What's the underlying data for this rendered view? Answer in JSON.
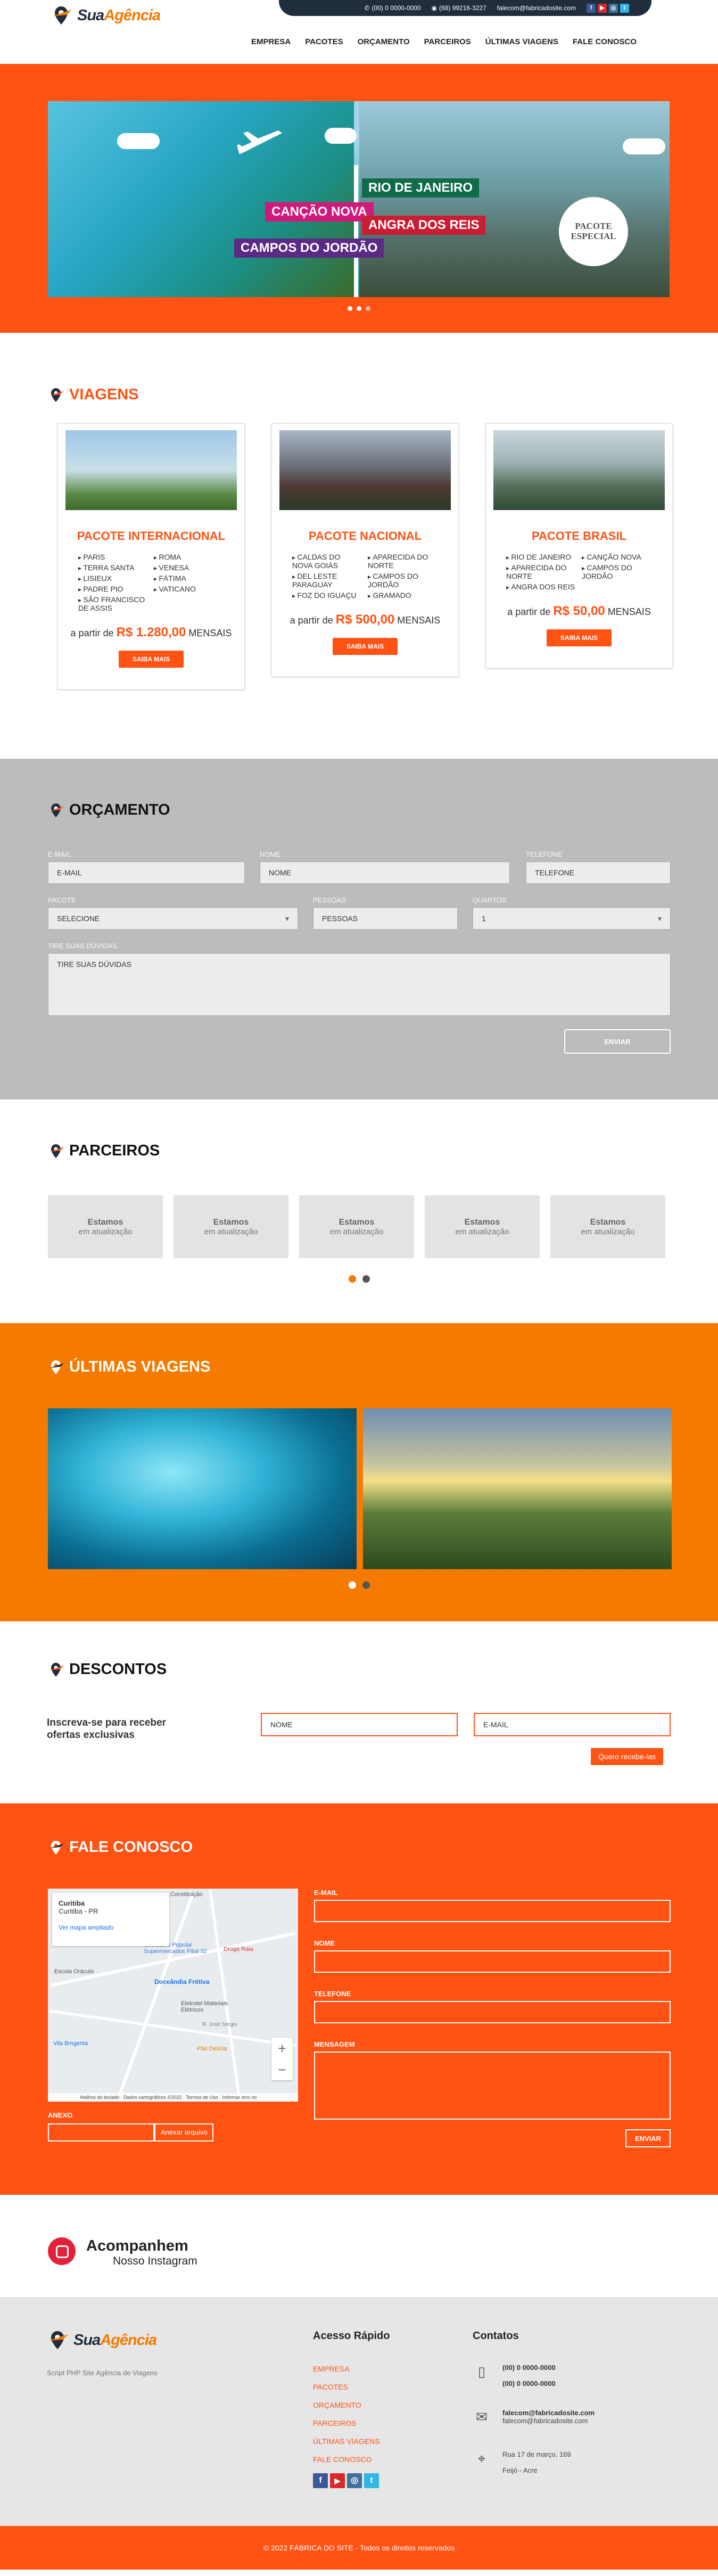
{
  "brand": {
    "logo_main": "Sua",
    "logo_accent": "Agência",
    "accent": "#ff5213",
    "dark": "#1f2d3d"
  },
  "topbar": {
    "phone1": "(00) 0 0000-0000",
    "phone2": "(68) 99216-3227",
    "email": "falecom@fabricadosite.com",
    "social": [
      "facebook-icon",
      "youtube-icon",
      "instagram-icon",
      "twitter-icon"
    ]
  },
  "nav": [
    "EMPRESA",
    "PACOTES",
    "ORÇAMENTO",
    "PARCEIROS",
    "ÚLTIMAS VIAGENS",
    "FALE CONOSCO"
  ],
  "hero": {
    "tags": [
      "CANÇÃO NOVA",
      "CAMPOS DO JORDÃO",
      "RIO DE JANEIRO",
      "ANGRA DOS REIS"
    ],
    "seal": "PACOTE ESPECIAL",
    "slides": 3,
    "active": 0
  },
  "viagens": {
    "title": "VIAGENS",
    "price_prefix": "a partir de",
    "price_suffix": "MENSAIS",
    "button": "SAIBA MAIS",
    "cards": [
      {
        "title": "PACOTE INTERNACIONAL",
        "items": [
          "PARIS",
          "ROMA",
          "TERRA SANTA",
          "VENESA",
          "LISIEUX",
          "FÁTIMA",
          "PADRE PIO",
          "VATICANO",
          "SÃO FRANCISCO DE ASSIS"
        ],
        "price": "R$ 1.280,00"
      },
      {
        "title": "PACOTE NACIONAL",
        "items": [
          "CALDAS DO NOVA GOIÁS",
          "APARECIDA DO NORTE",
          "DEL LESTE PARAGUAY",
          "CAMPOS DO JORDÃO",
          "FOZ DO IGUAÇU",
          "GRAMADO"
        ],
        "price": "R$ 500,00"
      },
      {
        "title": "PACOTE BRASIL",
        "items": [
          "RIO DE JANEIRO",
          "CANÇÃO NOVA",
          "APARECIDA DO NORTE",
          "CAMPOS DO JORDÃO",
          "ANGRA DOS REIS"
        ],
        "price": "R$ 50,00"
      }
    ]
  },
  "orcamento": {
    "title": "ORÇAMENTO",
    "labels": {
      "email": "E-MAIL",
      "nome": "NOME",
      "telefone": "TELEFONE",
      "pacote": "PACOTE",
      "pessoas": "PESSOAS",
      "quartos": "QUARTOS",
      "duvidas": "TIRE SUAS DÚVIDAS"
    },
    "values": {
      "email": "E-MAIL",
      "nome": "NOME",
      "telefone": "TELEFONE",
      "pacote": "SELECIONE",
      "pessoas": "PESSOAS",
      "quartos": "1",
      "duvidas": "TIRE SUAS DÚVIDAS"
    },
    "button": "ENVIAR"
  },
  "parceiros": {
    "title": "PARCEIROS",
    "items": [
      {
        "t1": "Estamos",
        "t2": "em atualização"
      },
      {
        "t1": "Estamos",
        "t2": "em atualização"
      },
      {
        "t1": "Estamos",
        "t2": "em atualização"
      },
      {
        "t1": "Estamos",
        "t2": "em atualização"
      },
      {
        "t1": "Estamos",
        "t2": "em atualização"
      }
    ]
  },
  "ultimas": {
    "title": "ÚLTIMAS VIAGENS"
  },
  "descontos": {
    "title": "DESCONTOS",
    "text": "Inscreva-se para receber ofertas exclusivas",
    "nome": "NOME",
    "email": "E-MAIL",
    "button": "Quero recebe-las"
  },
  "fale": {
    "title": "FALE CONOSCO",
    "map": {
      "city": "Curitiba",
      "state": "Curitiba - PR",
      "link": "Ver mapa ampliado",
      "places": [
        "Constituição",
        "Secretário Popular Supermercados Filial 32",
        "Droga Raia",
        "Escola Oráculo",
        "Doceândia Frétiva",
        "Eletrotel Materiais Elétricos",
        "Pão Delícia",
        "Vila Bmgenta",
        "R. José Sergio"
      ],
      "footer": "Atalhos do teclado · Dados cartográficos ©2022 · Termos de Uso · Informar erro no mapa"
    },
    "labels": {
      "email": "E-MAIL",
      "nome": "NOME",
      "telefone": "TELEFONE",
      "mensagem": "MENSAGEM",
      "anexo": "ANEXO"
    },
    "attach": "Anexar arquivo",
    "button": "ENVIAR"
  },
  "instagram": {
    "title": "Acompanhem",
    "sub": "Nosso Instagram"
  },
  "footer": {
    "tagline": "Script PHP Site Agência de Viagens",
    "quick_title": "Acesso Rápido",
    "links": [
      "EMPRESA",
      "PACOTES",
      "ORÇAMENTO",
      "PARCEIROS",
      "ÚLTIMAS VIAGENS",
      "FALE CONOSCO"
    ],
    "contact_title": "Contatos",
    "phone_a": "(00) 0 0000-0000",
    "phone_b": "(00) 0 0000-0000",
    "email_a": "falecom@fabricadosite.com",
    "email_b": "falecom@fabricadosite.com",
    "addr_a": "Rua 17 de março, 169",
    "addr_b": "Feijó - Acre",
    "copyright": "© 2022 FÁBRICA DO SITE - Todos os direitos reservados"
  }
}
